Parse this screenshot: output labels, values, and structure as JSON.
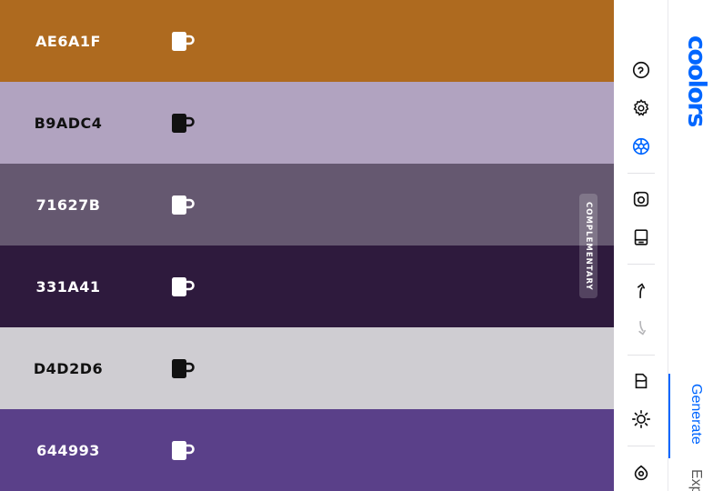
{
  "palette": {
    "colors": [
      {
        "hex": "AE6A1F",
        "color": "#AE6A1F",
        "text_color": "#ffffff"
      },
      {
        "hex": "B9ADC4",
        "color": "#B1A3C0",
        "text_color": "#111111"
      },
      {
        "hex": "71627B",
        "color": "#655870",
        "text_color": "#ffffff"
      },
      {
        "hex": "331A41",
        "color": "#2E1A3D",
        "text_color": "#ffffff"
      },
      {
        "hex": "D4D2D6",
        "color": "#CFCDD2",
        "text_color": "#111111"
      },
      {
        "hex": "644993",
        "color": "#5A4089",
        "text_color": "#ffffff"
      }
    ],
    "mode_label": "COMPLEMENTARY"
  },
  "toolbar": {
    "icons": [
      "clock-icon",
      "gear-icon",
      "color-wheel-icon",
      "camera-icon",
      "export-icon",
      "undo-icon",
      "redo-icon",
      "bookmark-icon",
      "sun-icon",
      "eye-icon"
    ],
    "active_color": "#0066ff"
  },
  "sidenav": {
    "logo": "coolors",
    "tabs": [
      {
        "label": "Generate",
        "active": true
      },
      {
        "label": "Exp",
        "active": false
      }
    ],
    "accent": "#0066ff"
  }
}
